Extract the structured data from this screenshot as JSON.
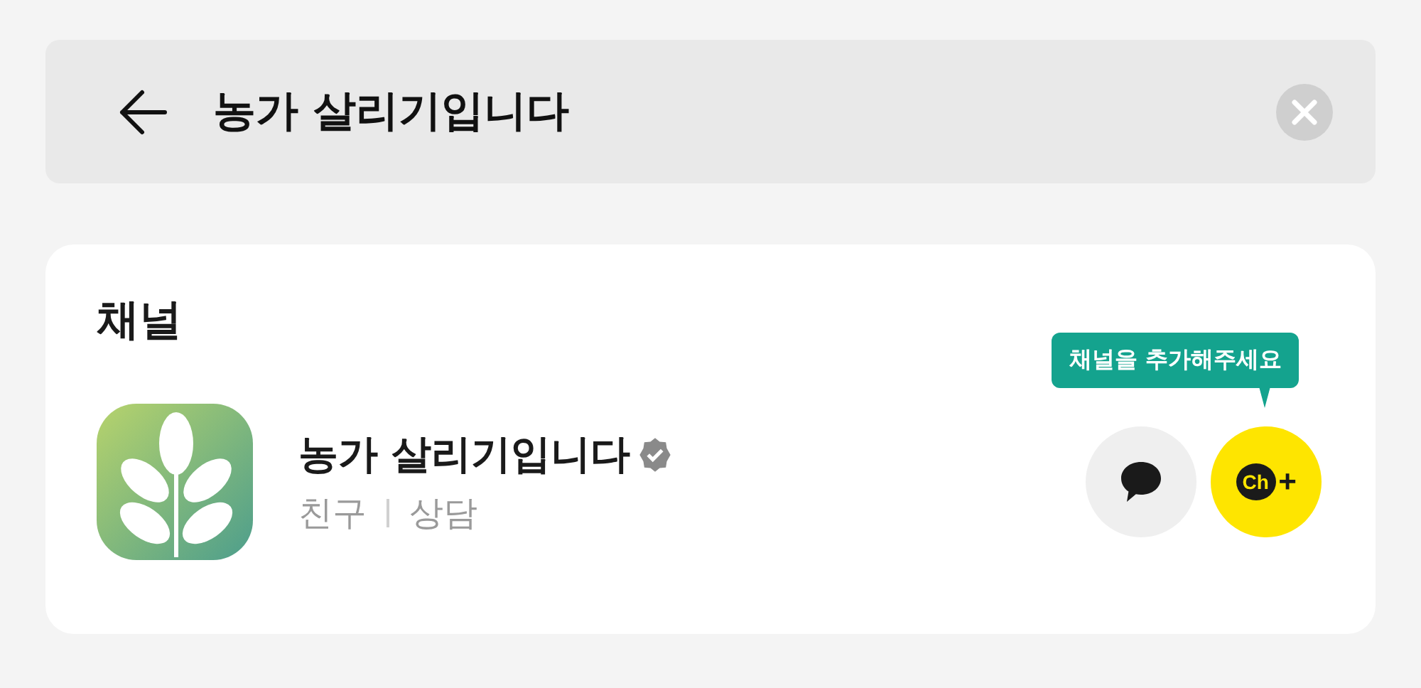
{
  "search": {
    "value": "농가 살리기입니다"
  },
  "section": {
    "title": "채널"
  },
  "channel": {
    "name": "농가 살리기입니다",
    "verified": true,
    "tags": [
      "친구",
      "상담"
    ],
    "tooltip": "채널을 추가해주세요",
    "add_label": "Ch",
    "add_plus": "+"
  }
}
